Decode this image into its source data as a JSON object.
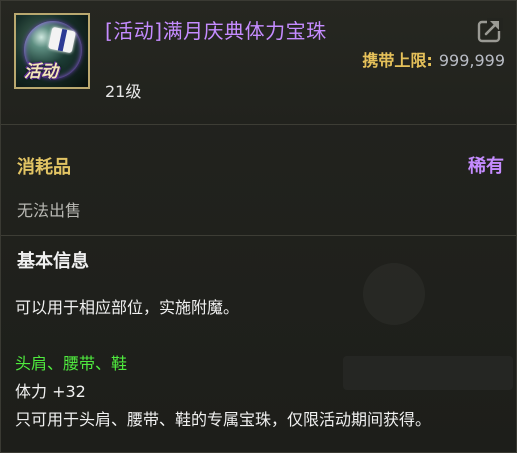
{
  "item": {
    "name": "[活动]满月庆典体力宝珠",
    "icon_badge": "活动",
    "icon_name": "gift-orb-icon",
    "carry_limit_label": "携带上限:",
    "carry_limit_value": "999,999",
    "level": "21级",
    "category": "消耗品",
    "rarity": "稀有",
    "trade_status": "无法出售"
  },
  "basic_info": {
    "title": "基本信息",
    "usage": "可以用于相应部位，实施附魔。",
    "slots": "头肩、腰带、鞋",
    "stat": "体力 +32",
    "description": "只可用于头肩、腰带、鞋的专属宝珠，仅限活动期间获得。"
  },
  "colors": {
    "name_purple": "#c58cff",
    "gold": "#e2c464",
    "green": "#4fea3e"
  }
}
